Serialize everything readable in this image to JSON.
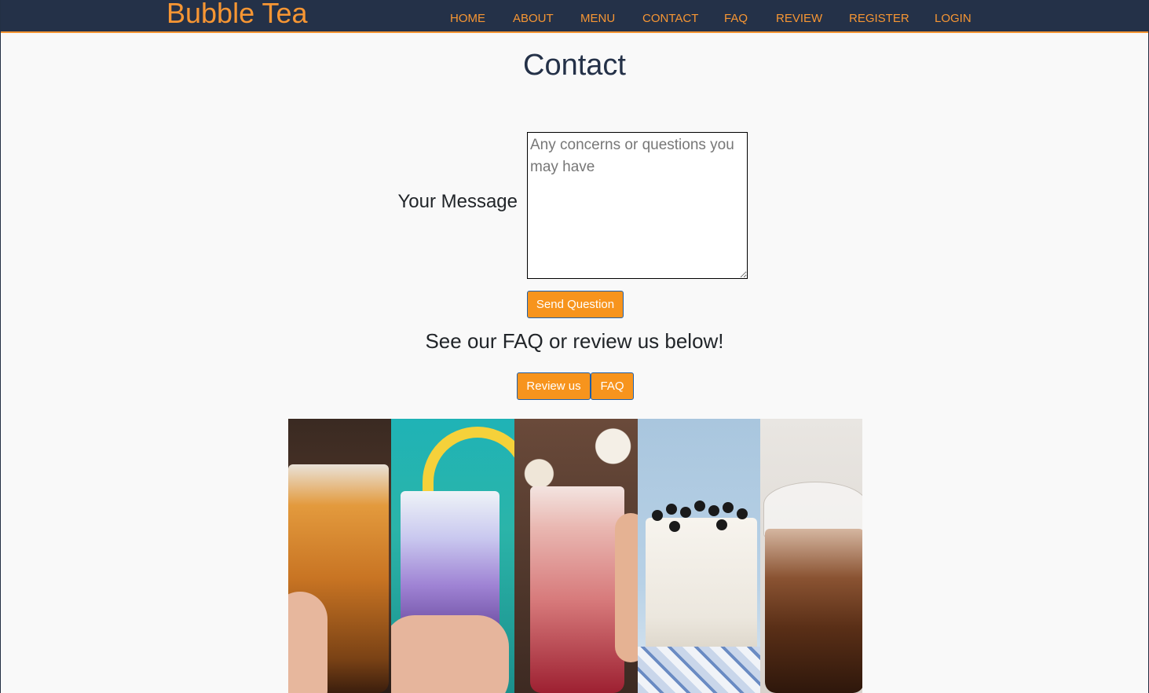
{
  "nav": {
    "brand": "Bubble Tea",
    "links": [
      {
        "label": "HOME"
      },
      {
        "label": "ABOUT"
      },
      {
        "label": "MENU"
      },
      {
        "label": "CONTACT"
      },
      {
        "label": "FAQ"
      },
      {
        "label": "REVIEW"
      },
      {
        "label": "REGISTER"
      },
      {
        "label": "LOGIN"
      }
    ]
  },
  "page": {
    "title": "Contact"
  },
  "form": {
    "message_label": "Your Message",
    "message_placeholder": "Any concerns or questions you may have",
    "message_value": "",
    "submit_label": "Send Question"
  },
  "faq_section": {
    "text": "See our FAQ or review us below!",
    "review_button": "Review us",
    "faq_button": "FAQ"
  },
  "colors": {
    "navbar": "#243148",
    "accent": "#f79633",
    "button": "#f7941d",
    "background": "#f9f9f9"
  }
}
